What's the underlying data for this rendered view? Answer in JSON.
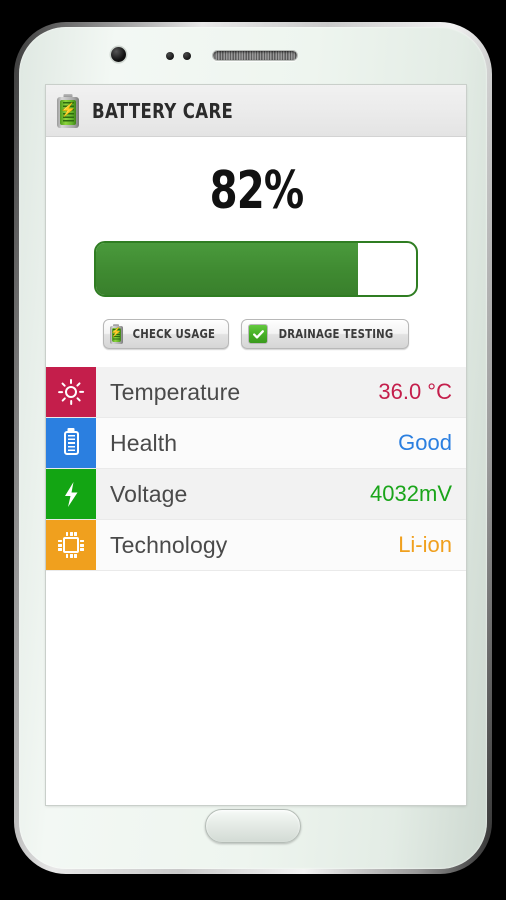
{
  "app": {
    "title": "BATTERY CARE",
    "icon": "battery-icon"
  },
  "battery": {
    "percent_label": "82%",
    "percent_value": 82,
    "fill_color": "#3f8a31",
    "border_color": "#2f7d22"
  },
  "actions": [
    {
      "label": "CHECK USAGE",
      "icon": "battery-icon"
    },
    {
      "label": "DRAINAGE TESTING",
      "icon": "check-box-icon"
    }
  ],
  "info_rows": [
    {
      "label": "Temperature",
      "value": "36.0 °C",
      "icon": "sun-icon",
      "tile_color": "#c41e4b",
      "value_color": "#c41e4b"
    },
    {
      "label": "Health",
      "value": "Good",
      "icon": "battery-icon",
      "tile_color": "#2b7fe0",
      "value_color": "#2b7fe0"
    },
    {
      "label": "Voltage",
      "value": "4032mV",
      "icon": "lightning-bolt-icon",
      "tile_color": "#13a513",
      "value_color": "#1aa51a"
    },
    {
      "label": "Technology",
      "value": "Li-ion",
      "icon": "chip-icon",
      "tile_color": "#f0a01e",
      "value_color": "#f0a01e"
    }
  ],
  "device": {
    "front_camera": "front-camera",
    "earpiece": "earpiece-speaker",
    "home_button": "home-button"
  }
}
